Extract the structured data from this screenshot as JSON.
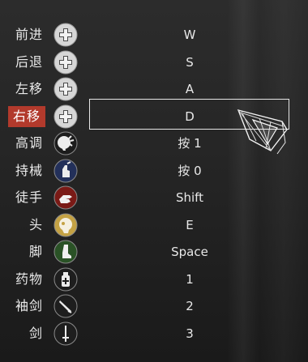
{
  "controls": [
    {
      "action": "前进",
      "key": "W",
      "icon": "dpad-icon",
      "selected": false
    },
    {
      "action": "后退",
      "key": "S",
      "icon": "dpad-icon",
      "selected": false
    },
    {
      "action": "左移",
      "key": "A",
      "icon": "dpad-icon",
      "selected": false
    },
    {
      "action": "右移",
      "key": "D",
      "icon": "dpad-icon",
      "selected": true
    },
    {
      "action": "高调",
      "key": "按 1",
      "icon": "high-profile-icon",
      "selected": false
    },
    {
      "action": "持械",
      "key": "按 0",
      "icon": "arm-weapon-icon",
      "selected": false
    },
    {
      "action": "徒手",
      "key": "Shift",
      "icon": "empty-hand-icon",
      "selected": false
    },
    {
      "action": "头",
      "key": "E",
      "icon": "head-icon",
      "selected": false
    },
    {
      "action": "脚",
      "key": "Space",
      "icon": "foot-icon",
      "selected": false
    },
    {
      "action": "药物",
      "key": "1",
      "icon": "medicine-icon",
      "selected": false
    },
    {
      "action": "袖剑",
      "key": "2",
      "icon": "hidden-blade-icon",
      "selected": false
    },
    {
      "action": "剑",
      "key": "3",
      "icon": "sword-icon",
      "selected": false
    }
  ],
  "colors": {
    "selected_label_bg": "#b23a2c",
    "selection_border": "#e6e6e6",
    "dpad_fill": "#d8d8d8",
    "head_button_fill": "#c8a44a",
    "hand_button_fill": "#8a1f1a",
    "foot_button_fill": "#2f5a2a",
    "arm_button_fill": "#2b3a6a",
    "high_profile_fill": "#e8e8e8"
  }
}
